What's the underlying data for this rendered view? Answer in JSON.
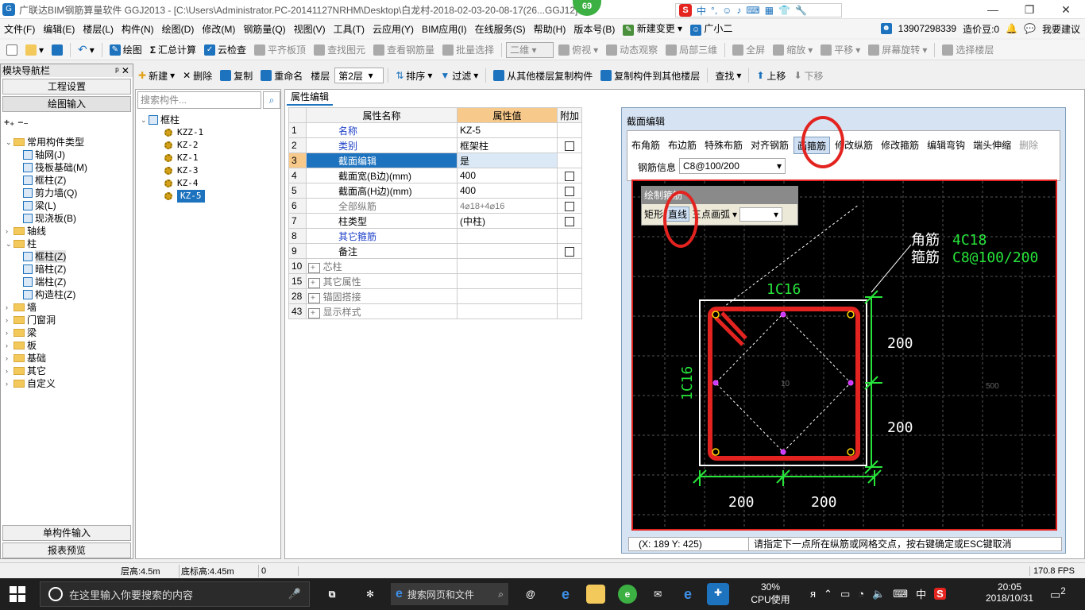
{
  "window": {
    "title": "广联达BIM钢筋算量软件 GGJ2013 - [C:\\Users\\Administrator.PC-20141127NRHM\\Desktop\\白龙村-2018-02-03-20-08-17(26...GGJ12]",
    "badge": "69",
    "ime_text": "中"
  },
  "menubar": {
    "items": [
      "文件(F)",
      "编辑(E)",
      "楼层(L)",
      "构件(N)",
      "绘图(D)",
      "修改(M)",
      "钢筋量(Q)",
      "视图(V)",
      "工具(T)",
      "云应用(Y)",
      "BIM应用(I)",
      "在线服务(S)",
      "帮助(H)",
      "版本号(B)",
      "新建变更",
      "广小二"
    ],
    "phone": "13907298339",
    "price": "造价豆:0",
    "suggest": "我要建议"
  },
  "toolbar1": {
    "draw": "绘图",
    "sum": "汇总计算",
    "cloudcheck": "云检查",
    "flatroof": "平齐板顶",
    "findelem": "查找图元",
    "viewrebar": "查看钢筋量",
    "batchselect": "批量选择",
    "view2d": "二维",
    "topview": "俯视",
    "dynamic": "动态观察",
    "local3d": "局部三维",
    "fullscreen": "全屏",
    "zoom": "缩放",
    "pan": "平移",
    "rotate": "屏幕旋转",
    "selectfloor": "选择楼层"
  },
  "nav": {
    "header": "模块导航栏",
    "btn_project": "工程设置",
    "btn_draw": "绘图输入",
    "btn_single": "单构件输入",
    "btn_report": "报表预览",
    "tree": [
      {
        "label": "常用构件类型",
        "level": 0,
        "type": "folder",
        "open": true
      },
      {
        "label": "轴网(J)",
        "level": 1,
        "type": "item"
      },
      {
        "label": "筏板基础(M)",
        "level": 1,
        "type": "item"
      },
      {
        "label": "框柱(Z)",
        "level": 1,
        "type": "item"
      },
      {
        "label": "剪力墙(Q)",
        "level": 1,
        "type": "item"
      },
      {
        "label": "梁(L)",
        "level": 1,
        "type": "item"
      },
      {
        "label": "现浇板(B)",
        "level": 1,
        "type": "item"
      },
      {
        "label": "轴线",
        "level": 0,
        "type": "folder"
      },
      {
        "label": "柱",
        "level": 0,
        "type": "folder",
        "open": true
      },
      {
        "label": "框柱(Z)",
        "level": 1,
        "type": "item",
        "selected": true
      },
      {
        "label": "暗柱(Z)",
        "level": 1,
        "type": "item"
      },
      {
        "label": "端柱(Z)",
        "level": 1,
        "type": "item"
      },
      {
        "label": "构造柱(Z)",
        "level": 1,
        "type": "item"
      },
      {
        "label": "墙",
        "level": 0,
        "type": "folder"
      },
      {
        "label": "门窗洞",
        "level": 0,
        "type": "folder"
      },
      {
        "label": "梁",
        "level": 0,
        "type": "folder"
      },
      {
        "label": "板",
        "level": 0,
        "type": "folder"
      },
      {
        "label": "基础",
        "level": 0,
        "type": "folder"
      },
      {
        "label": "其它",
        "level": 0,
        "type": "folder"
      },
      {
        "label": "自定义",
        "level": 0,
        "type": "folder"
      }
    ]
  },
  "toolbar2": {
    "new": "新建",
    "delete": "删除",
    "copy": "复制",
    "rename": "重命名",
    "floor_label": "楼层",
    "floor_value": "第2层",
    "sort": "排序",
    "filter": "过滤",
    "copy_from": "从其他楼层复制构件",
    "copy_to": "复制构件到其他楼层",
    "find": "查找",
    "up": "上移",
    "down": "下移"
  },
  "complist": {
    "search_placeholder": "搜索构件...",
    "root": "框柱",
    "items": [
      "KZZ-1",
      "KZ-2",
      "KZ-1",
      "KZ-3",
      "KZ-4",
      "KZ-5"
    ],
    "selected_index": 5
  },
  "props": {
    "tab": "属性编辑",
    "col_name": "属性名称",
    "col_value": "属性值",
    "col_extra": "附加",
    "rows": [
      {
        "no": "1",
        "name": "名称",
        "value": "KZ-5",
        "chk": false,
        "blue": true
      },
      {
        "no": "2",
        "name": "类别",
        "value": "框架柱",
        "chk": true,
        "blue": true
      },
      {
        "no": "3",
        "name": "截面编辑",
        "value": "是",
        "chk": false,
        "sel": true
      },
      {
        "no": "4",
        "name": "截面宽(B边)(mm)",
        "value": "400",
        "chk": true
      },
      {
        "no": "5",
        "name": "截面高(H边)(mm)",
        "value": "400",
        "chk": true
      },
      {
        "no": "6",
        "name": "全部纵筋",
        "value": "4⌀18+4⌀16",
        "chk": true,
        "gray": true
      },
      {
        "no": "7",
        "name": "柱类型",
        "value": "(中柱)",
        "chk": true
      },
      {
        "no": "8",
        "name": "其它箍筋",
        "value": "",
        "chk": false,
        "blue": true
      },
      {
        "no": "9",
        "name": "备注",
        "value": "",
        "chk": true
      },
      {
        "no": "10",
        "name": "芯柱",
        "value": "",
        "chk": false,
        "group": true
      },
      {
        "no": "15",
        "name": "其它属性",
        "value": "",
        "chk": false,
        "group": true
      },
      {
        "no": "28",
        "name": "锚固搭接",
        "value": "",
        "chk": false,
        "group": true
      },
      {
        "no": "43",
        "name": "显示样式",
        "value": "",
        "chk": false,
        "group": true
      }
    ]
  },
  "section": {
    "title": "截面编辑",
    "tools": [
      "布角筋",
      "布边筋",
      "特殊布筋",
      "对齐钢筋",
      "画箍筋",
      "修改纵筋",
      "修改箍筋",
      "编辑弯钩",
      "端头伸缩",
      "删除"
    ],
    "rebar_info_label": "钢筋信息",
    "rebar_info_value": "C8@100/200",
    "draw_panel_title": "绘制箍筋",
    "draw_rect": "矩形",
    "draw_line": "直线",
    "draw_arc": "三点画弧",
    "corner_label": "角筋",
    "corner_value": "4C18",
    "stirrup_label": "箍筋",
    "stirrup_value": "C8@100/200",
    "top_side": "1C16",
    "left_side": "1C16",
    "dim_right_top": "200",
    "dim_right_bottom": "200",
    "dim_bottom_left": "200",
    "dim_bottom_right": "200",
    "center_mark": "10",
    "right_mark": "500",
    "coords": "(X: 189 Y: 425)",
    "hint": "请指定下一点所在纵筋或网格交点，按右键确定或ESC键取消"
  },
  "statusbar": {
    "floor_height": "层高:4.5m",
    "base_height": "底标高:4.45m",
    "zero": "0",
    "fps": "170.8 FPS"
  },
  "taskbar": {
    "search": "在这里输入你要搜索的内容",
    "web_search": "搜索网页和文件",
    "cpu_pct": "30%",
    "cpu_label": "CPU使用",
    "ime": "中",
    "time": "20:05",
    "date": "2018/10/31",
    "notif": "2"
  }
}
